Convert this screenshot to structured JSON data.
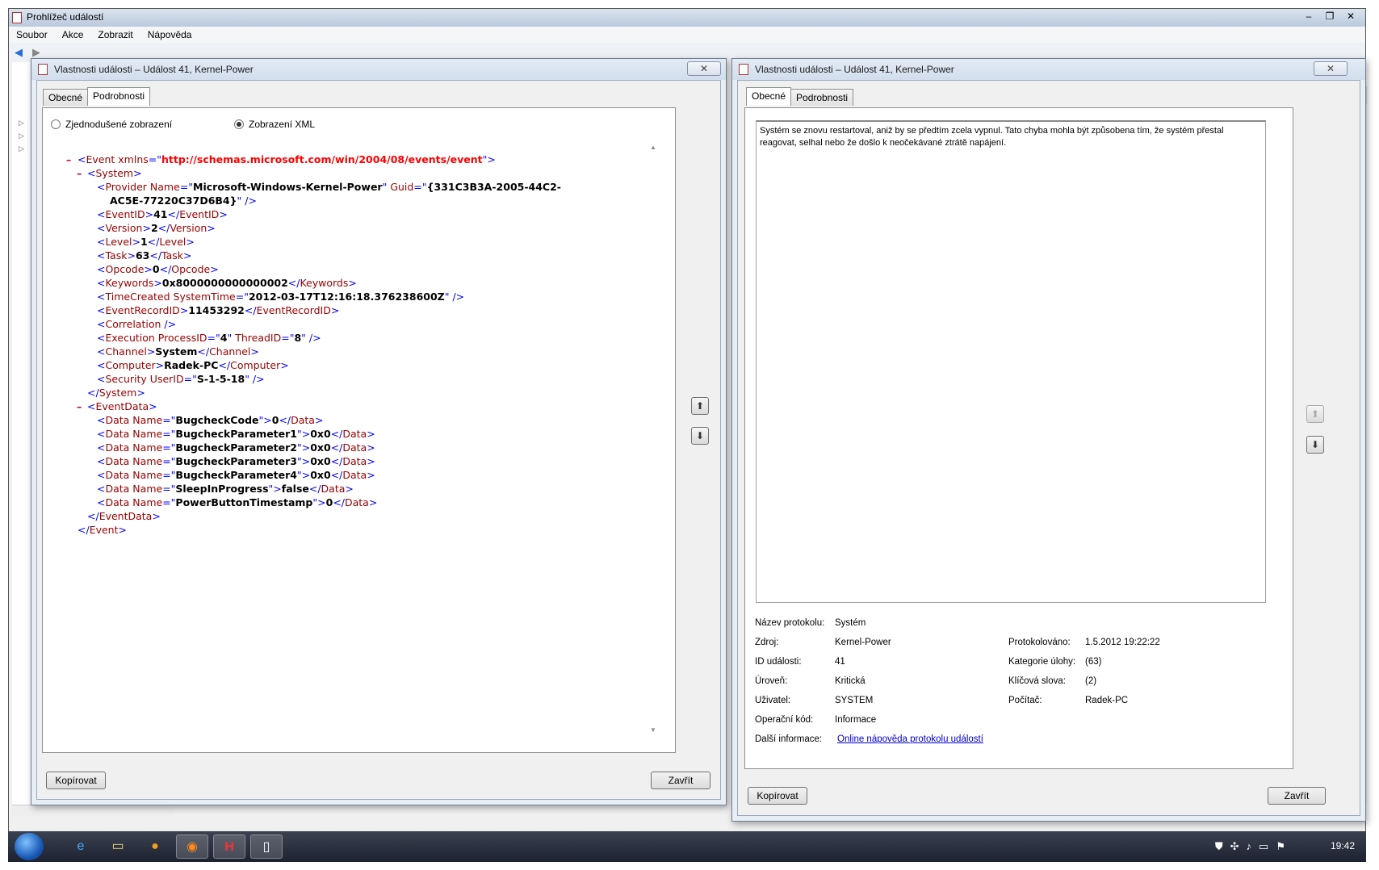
{
  "main_window": {
    "title": "Prohlížeč událostí",
    "menu": [
      "Soubor",
      "Akce",
      "Zobrazit",
      "Nápověda"
    ]
  },
  "left_dialog": {
    "title": "Vlastnosti události – Událost 41, Kernel-Power",
    "close_icon": "✕",
    "tabs": [
      "Obecné",
      "Podrobnosti"
    ],
    "active_tab": "Podrobnosti",
    "radio_simple": "Zjednodušené zobrazení",
    "radio_xml": "Zobrazení XML",
    "selected_view": "Zobrazení XML",
    "copy_button": "Kopírovat",
    "close_button": "Zavřít",
    "xml": {
      "event_ns_attr": "xmlns",
      "event_ns_value": "http://schemas.microsoft.com/win/2004/08/events/event",
      "provider_name": "Microsoft-Windows-Kernel-Power",
      "provider_guid_1": "{331C3B3A-2005-44C2-",
      "provider_guid_2": "AC5E-77220C37D6B4}",
      "event_id": "41",
      "version": "2",
      "level": "1",
      "task": "63",
      "opcode": "0",
      "keywords": "0x8000000000000002",
      "time_created": "2012-03-17T12:16:18.376238600Z",
      "event_record_id": "11453292",
      "process_id": "4",
      "thread_id": "8",
      "channel": "System",
      "computer": "Radek-PC",
      "user_id": "S-1-5-18",
      "data": [
        {
          "name": "BugcheckCode",
          "value": "0"
        },
        {
          "name": "BugcheckParameter1",
          "value": "0x0"
        },
        {
          "name": "BugcheckParameter2",
          "value": "0x0"
        },
        {
          "name": "BugcheckParameter3",
          "value": "0x0"
        },
        {
          "name": "BugcheckParameter4",
          "value": "0x0"
        },
        {
          "name": "SleepInProgress",
          "value": "false"
        },
        {
          "name": "PowerButtonTimestamp",
          "value": "0"
        }
      ]
    }
  },
  "right_dialog": {
    "title": "Vlastnosti události – Událost 41, Kernel-Power",
    "close_icon": "✕",
    "tabs": [
      "Obecné",
      "Podrobnosti"
    ],
    "active_tab": "Obecné",
    "message": "Systém se znovu restartoval, aniž by se předtím zcela vypnul. Tato chyba mohla být způsobena tím, že systém přestal reagovat, selhal nebo že došlo k neočekávané ztrátě napájení.",
    "fields": {
      "log_name_label": "Název protokolu:",
      "log_name": "Systém",
      "source_label": "Zdroj:",
      "source": "Kernel-Power",
      "logged_label": "Protokolováno:",
      "logged": "1.5.2012 19:22:22",
      "event_id_label": "ID události:",
      "event_id": "41",
      "task_category_label": "Kategorie úlohy:",
      "task_category": "(63)",
      "level_label": "Úroveň:",
      "level": "Kritická",
      "keywords_label": "Klíčová slova:",
      "keywords": "(2)",
      "user_label": "Uživatel:",
      "user": "SYSTEM",
      "computer_label": "Počítač:",
      "computer": "Radek-PC",
      "opcode_label": "Operační kód:",
      "opcode": "Informace",
      "more_info_label": "Další informace:",
      "more_info_link": "Online nápověda protokolu událostí"
    },
    "copy_button": "Kopírovat",
    "close_button": "Zavřít"
  },
  "taskbar": {
    "clock": "19:42"
  }
}
